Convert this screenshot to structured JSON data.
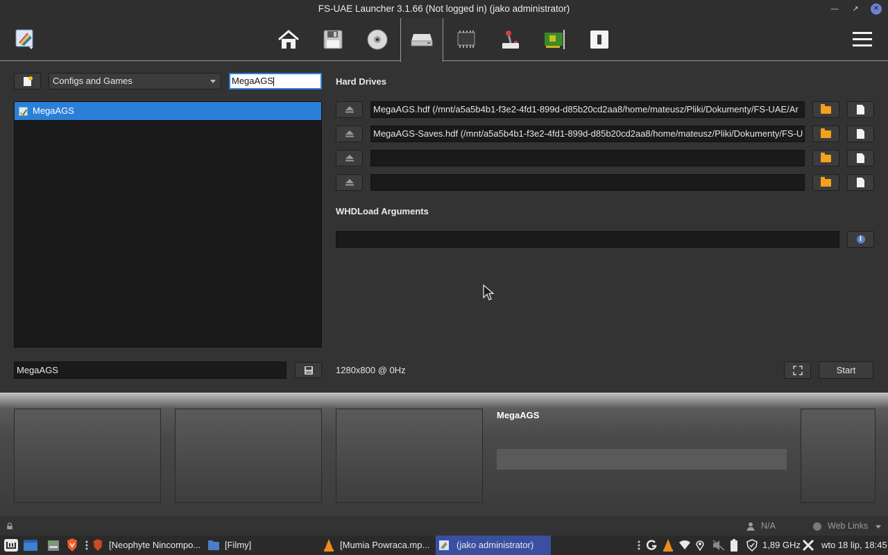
{
  "window": {
    "title": "FS-UAE Launcher 3.1.66 (Not logged in) (jako administrator)",
    "controls": [
      "minimize",
      "maximize",
      "close"
    ]
  },
  "toolbar": {
    "icons": [
      "app-logo-icon",
      "home-icon",
      "floppy-icon",
      "cd-icon",
      "hard-drive-icon",
      "memory-icon",
      "joystick-icon",
      "expansion-card-icon",
      "rom-icon",
      "menu-icon"
    ],
    "active": "hard-drive-icon"
  },
  "left_panel": {
    "source_select": "Configs and Games",
    "search_value": "MegaAGS",
    "list_items": [
      "MegaAGS"
    ],
    "config_name_value": "MegaAGS"
  },
  "hard_drives": {
    "title": "Hard Drives",
    "drives": [
      "MegaAGS.hdf (/mnt/a5a5b4b1-f3e2-4fd1-899d-d85b20cd2aa8/home/mateusz/Pliki/Dokumenty/FS-UAE/Ar",
      "MegaAGS-Saves.hdf (/mnt/a5a5b4b1-f3e2-4fd1-899d-d85b20cd2aa8/home/mateusz/Pliki/Dokumenty/FS-U",
      "",
      ""
    ]
  },
  "whdload": {
    "title": "WHDLoad Arguments",
    "value": ""
  },
  "footer": {
    "resolution": "1280x800 @ 0Hz",
    "start_label": "Start"
  },
  "game_info": {
    "title": "MegaAGS"
  },
  "statusbar": {
    "user": "N/A",
    "web_links": "Web Links"
  },
  "taskbar": {
    "items": [
      {
        "label": "[Neophyte Nincompo...",
        "active": false
      },
      {
        "label": "[Filmy]",
        "active": false
      },
      {
        "label": "[Mumia Powraca.mp...",
        "active": false
      },
      {
        "label": "(jako administrator)",
        "active": true
      }
    ],
    "cpu": "1,89 GHz",
    "clock": "wto 18 lip, 18:45"
  }
}
